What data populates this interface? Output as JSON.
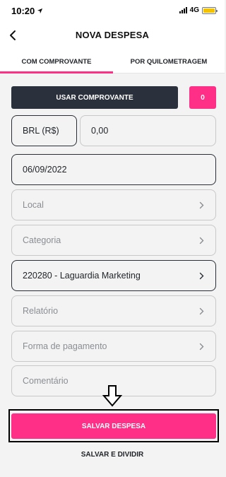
{
  "status_bar": {
    "time": "10:20",
    "network": "4G"
  },
  "header": {
    "title": "NOVA DESPESA"
  },
  "tabs": [
    {
      "label": "COM COMPROVANTE",
      "active": true
    },
    {
      "label": "POR QUILOMETRAGEM",
      "active": false
    }
  ],
  "receipt": {
    "button_label": "USAR COMPROVANTE",
    "count": "0"
  },
  "form": {
    "currency": "BRL (R$)",
    "amount": "0,00",
    "date": "06/09/2022",
    "location_placeholder": "Local",
    "category_placeholder": "Categoria",
    "project": "220280 - Laguardia Marketing",
    "report_placeholder": "Relatório",
    "payment_placeholder": "Forma de pagamento",
    "comment_placeholder": "Comentário"
  },
  "actions": {
    "save_label": "SALVAR DESPESA",
    "save_split_label": "SALVAR E DIVIDIR"
  },
  "colors": {
    "accent": "#ff2e86",
    "dark_button": "#2b313c",
    "battery": "#f5c200"
  },
  "icons": [
    "location-arrow-icon",
    "signal-icon",
    "battery-icon",
    "chevron-left-icon",
    "chevron-right-icon",
    "down-arrow-icon"
  ]
}
